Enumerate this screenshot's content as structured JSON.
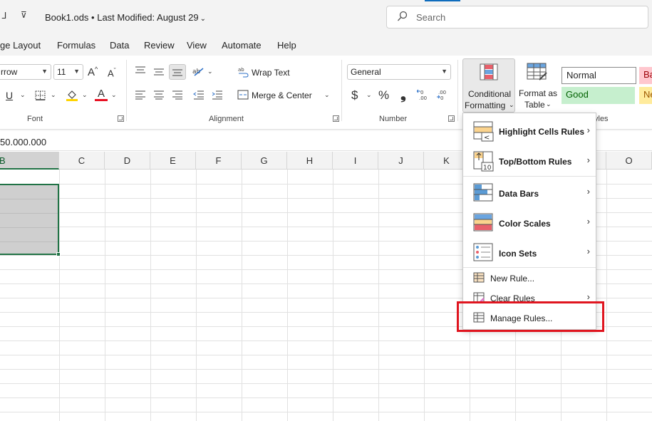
{
  "titlebar": {
    "quick_access_glyph": "ᒧ",
    "customize_glyph": "⊽",
    "document_title": "Book1.ods • Last Modified: August 29",
    "search_placeholder": "Search"
  },
  "tabs": [
    "ge Layout",
    "Formulas",
    "Data",
    "Review",
    "View",
    "Automate",
    "Help"
  ],
  "ribbon": {
    "font": {
      "font_name": "rrow",
      "font_size": "11",
      "grow_label": "A",
      "shrink_label": "A",
      "underline_label": "U",
      "font_color_label": "A",
      "group_label": "Font"
    },
    "alignment": {
      "wrap_text": "Wrap Text",
      "merge_center": "Merge & Center",
      "group_label": "Alignment"
    },
    "number": {
      "format": "General",
      "currency_symbol": "$",
      "percent_symbol": "%",
      "comma_symbol": "❟",
      "group_label": "Number"
    },
    "styles": {
      "conditional_formatting_line1": "Conditional",
      "conditional_formatting_line2": "Formatting",
      "format_as_table_line1": "Format as",
      "format_as_table_line2": "Table",
      "normal": "Normal",
      "bad": "Ba",
      "good": "Good",
      "neutral": "Ne",
      "group_label_partial": "yles"
    }
  },
  "formula_bar": {
    "value": "50.000.000"
  },
  "columns": [
    "B",
    "C",
    "D",
    "E",
    "F",
    "G",
    "H",
    "I",
    "J",
    "K",
    "O"
  ],
  "cf_menu": {
    "items": [
      {
        "label": "Highlight Cells Rules",
        "has_submenu": true
      },
      {
        "label": "Top/Bottom Rules",
        "has_submenu": true
      },
      {
        "label": "Data Bars",
        "has_submenu": true
      },
      {
        "label": "Color Scales",
        "has_submenu": true
      },
      {
        "label": "Icon Sets",
        "has_submenu": true
      },
      {
        "label": "New Rule...",
        "has_submenu": false
      },
      {
        "label": "Clear Rules",
        "has_submenu": true
      },
      {
        "label": "Manage Rules...",
        "has_submenu": false
      }
    ],
    "top_bottom_icon_text": "10",
    "highlight_icon_text": "<"
  },
  "colors": {
    "accent_green": "#217346",
    "highlight_red": "#e0151f",
    "bad_fill": "#ffc7ce",
    "good_fill": "#c6efce",
    "neutral_fill": "#ffeb9c"
  }
}
